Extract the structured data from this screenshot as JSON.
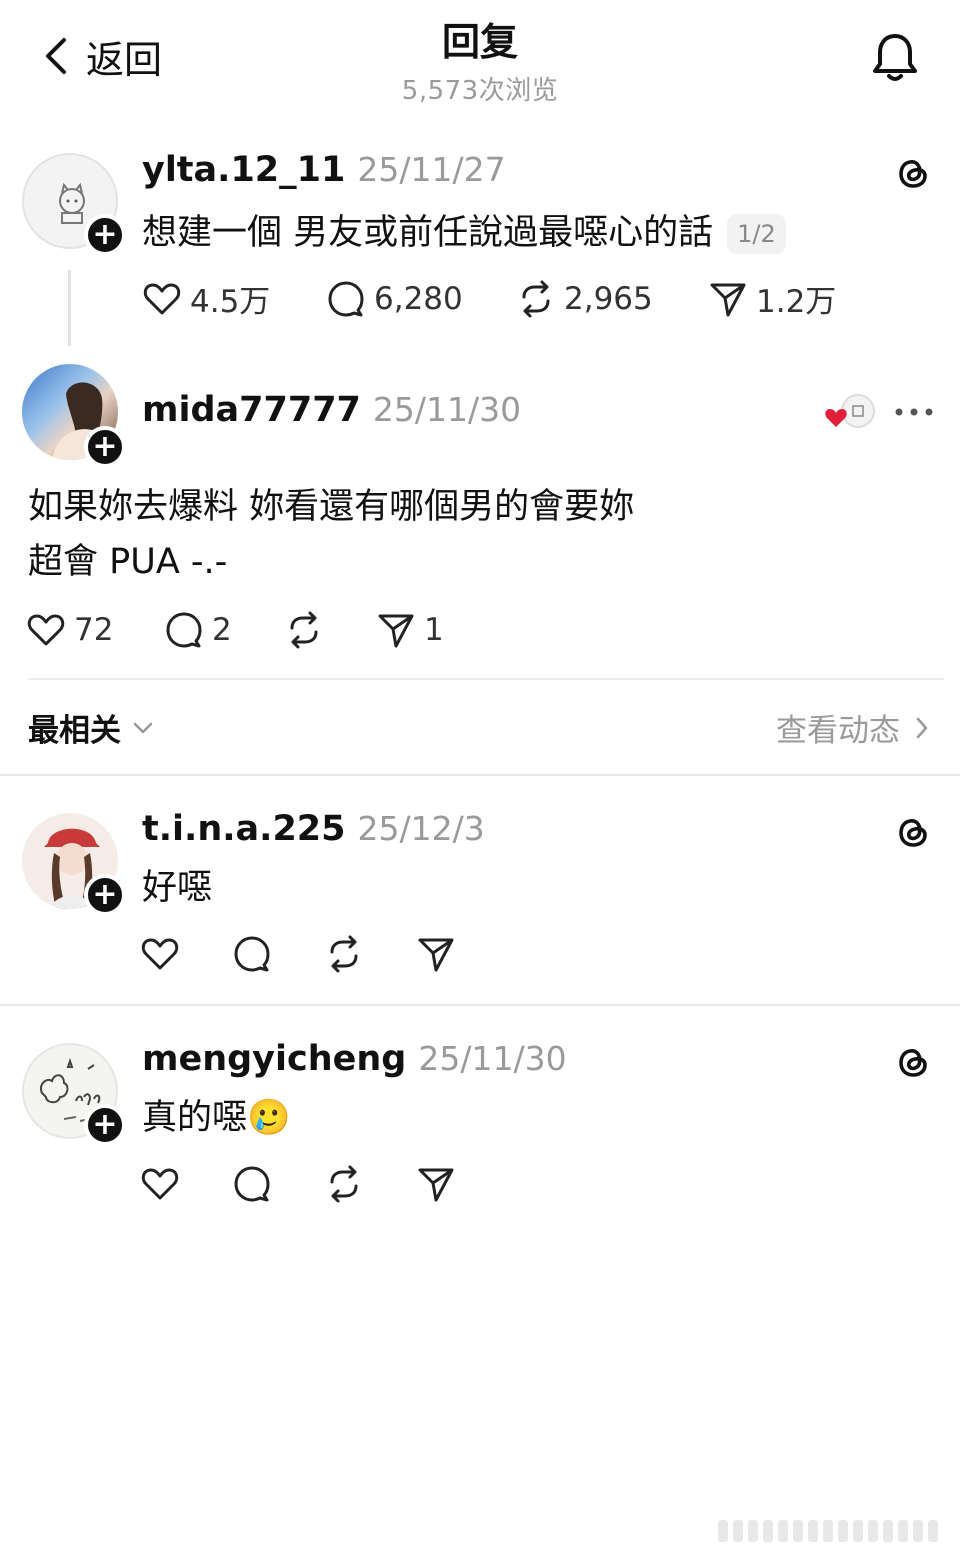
{
  "header": {
    "back_label": "返回",
    "title": "回复",
    "views": "5,573次浏览"
  },
  "original_post": {
    "username": "ylta.12_11",
    "date": "25/11/27",
    "text": "想建一個 男友或前任說過最噁心的話",
    "page_badge": "1/2",
    "likes": "4.5万",
    "comments": "6,280",
    "reposts": "2,965",
    "shares": "1.2万"
  },
  "reply_post": {
    "username": "mida77777",
    "date": "25/11/30",
    "text_line1": "如果妳去爆料 妳看還有哪個男的會要妳",
    "text_line2": "超會 PUA -.-",
    "likes": "72",
    "comments": "2",
    "shares": "1"
  },
  "sort_bar": {
    "sort_label": "最相关",
    "activity_label": "查看动态"
  },
  "comments": [
    {
      "username": "t.i.n.a.225",
      "date": "25/12/3",
      "text": "好噁"
    },
    {
      "username": "mengyicheng",
      "date": "25/11/30",
      "text": "真的噁",
      "emoji": "🥲"
    }
  ],
  "colors": {
    "text_primary": "#111111",
    "text_secondary": "#9a9a9a",
    "liked_heart": "#e0203a",
    "divider": "#ececec"
  },
  "icons": [
    "back-chevron-icon",
    "bell-icon",
    "threads-logo-icon",
    "heart-icon",
    "comment-bubble-icon",
    "repost-icon",
    "share-send-icon",
    "chevron-down-icon",
    "chevron-right-icon",
    "more-dots-icon"
  ]
}
